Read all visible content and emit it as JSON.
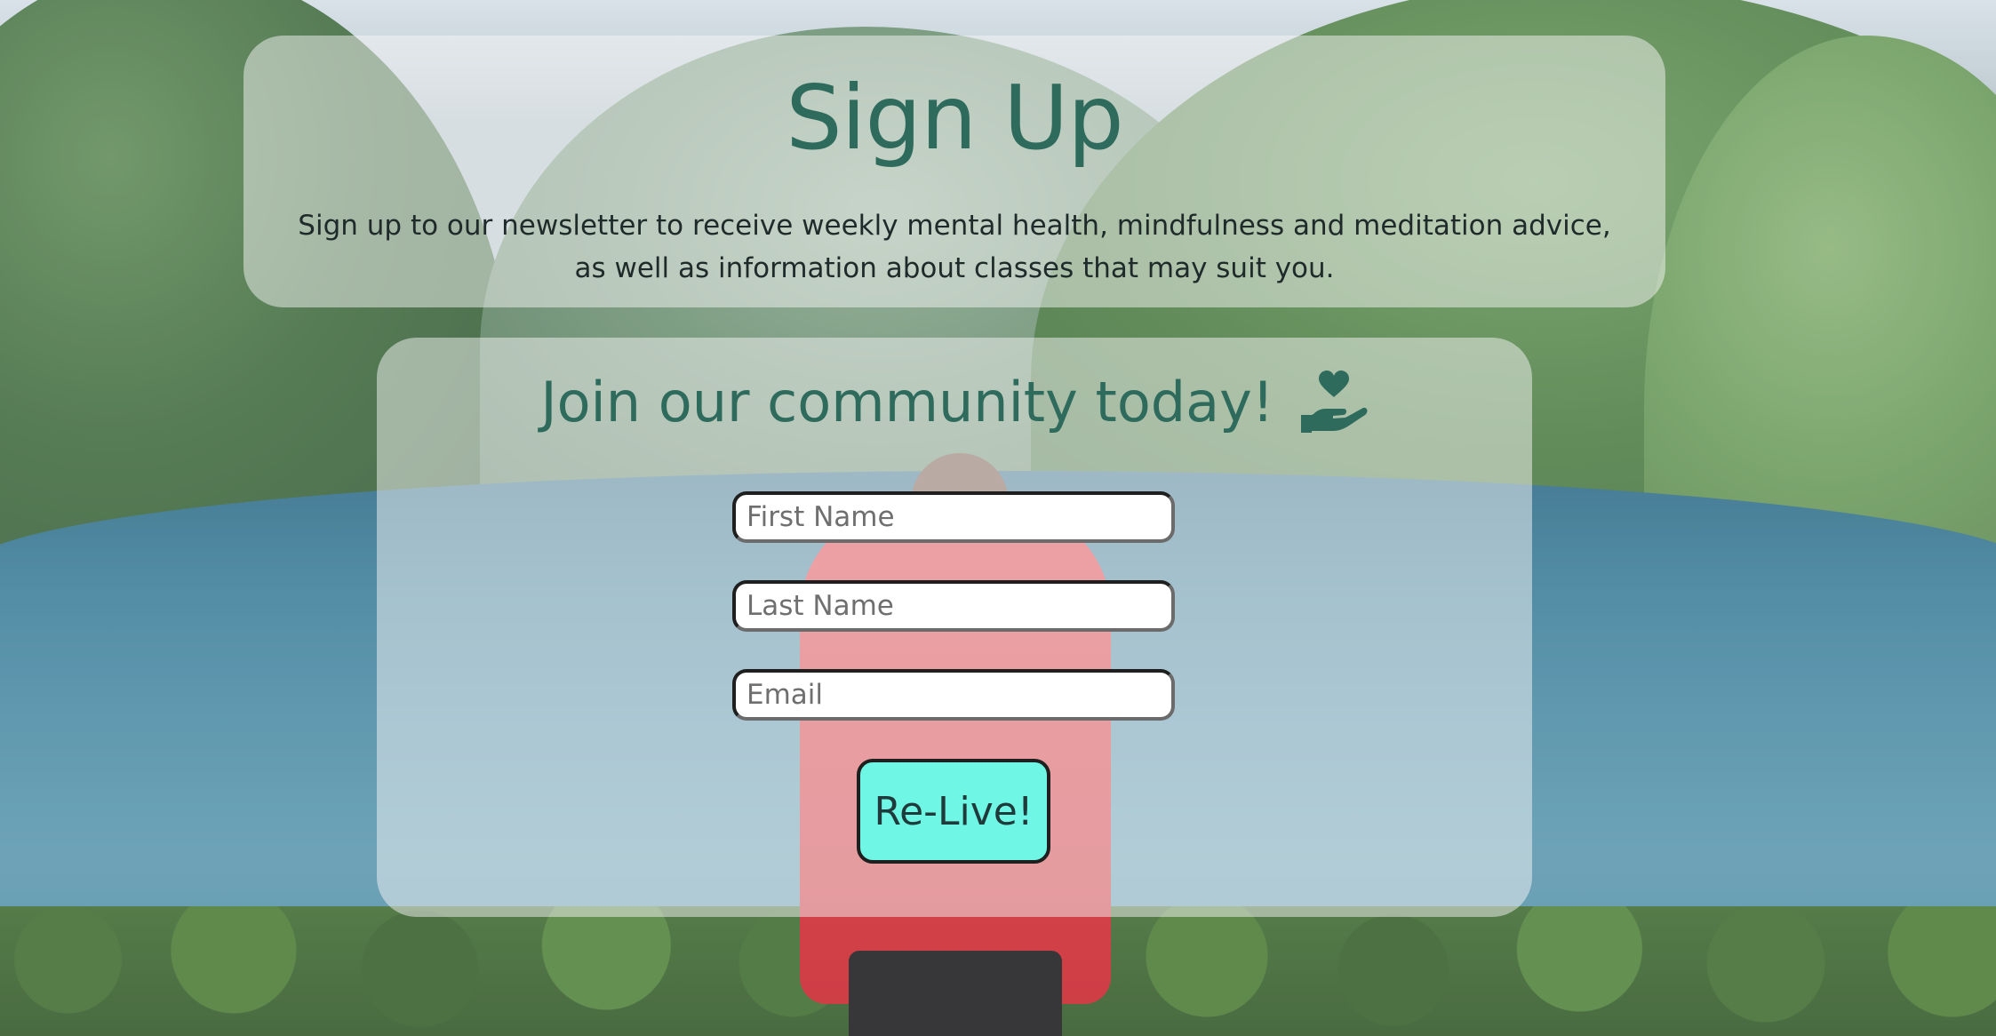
{
  "header": {
    "title": "Sign Up",
    "intro": "Sign up to our newsletter to receive weekly mental health, mindfulness and meditation advice, as well as information about classes that may suit you."
  },
  "form": {
    "heading": "Join our community today!",
    "heading_icon": "hand-holding-heart-icon",
    "fields": {
      "first_name": {
        "placeholder": "First Name",
        "value": ""
      },
      "last_name": {
        "placeholder": "Last Name",
        "value": ""
      },
      "email": {
        "placeholder": "Email",
        "value": ""
      }
    },
    "submit_label": "Re-Live!"
  },
  "colors": {
    "accent_text": "#2e6b5d",
    "button_bg": "#6ff6e4",
    "card_bg": "rgba(245,245,245,0.5)"
  }
}
